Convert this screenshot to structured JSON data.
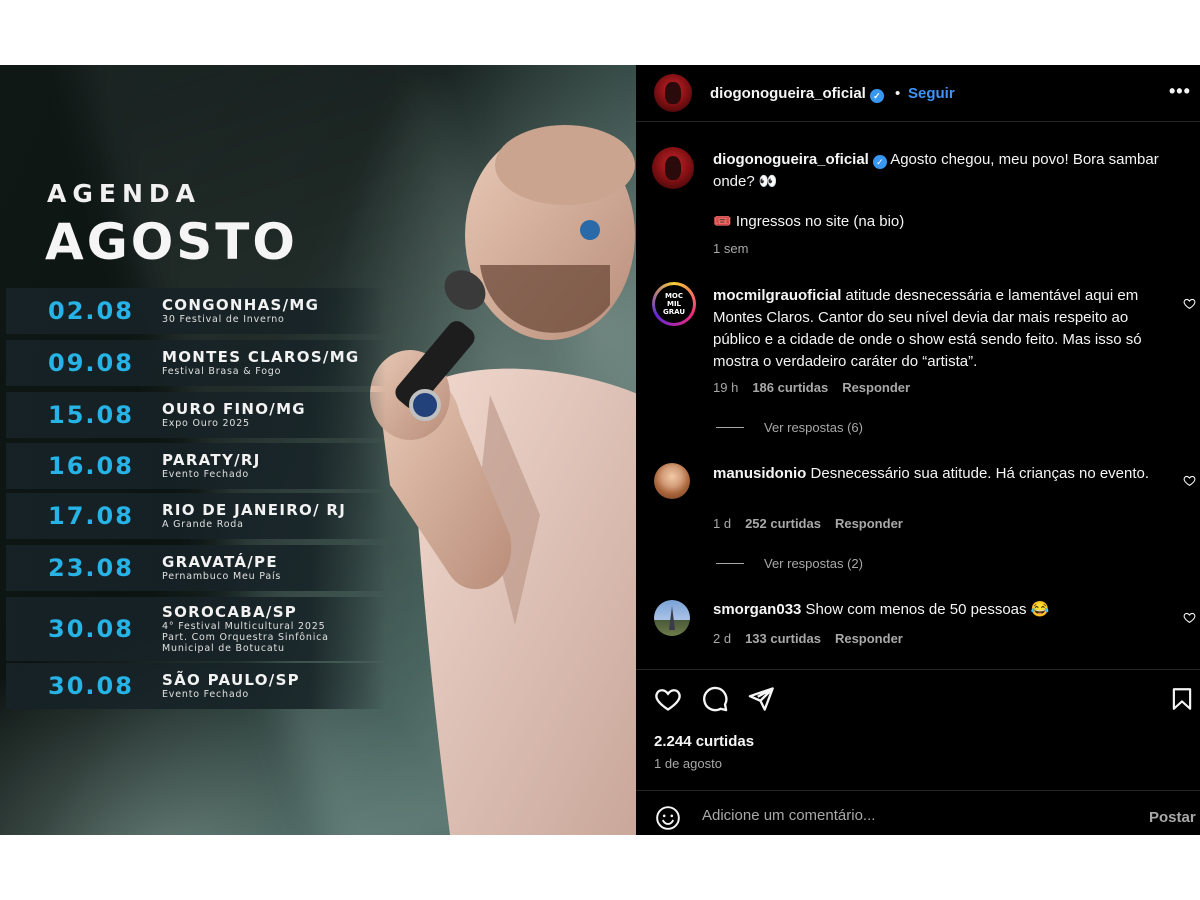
{
  "poster": {
    "title_small": "AGENDA",
    "title_big": "AGOSTO",
    "shows": [
      {
        "date": "02.08",
        "city": "CONGONHAS/MG",
        "details": [
          "30 Festival de Inverno"
        ]
      },
      {
        "date": "09.08",
        "city": "MONTES CLAROS/MG",
        "details": [
          "Festival Brasa & Fogo"
        ]
      },
      {
        "date": "15.08",
        "city": "OURO FINO/MG",
        "details": [
          "Expo Ouro 2025"
        ]
      },
      {
        "date": "16.08",
        "city": "PARATY/RJ",
        "details": [
          "Evento Fechado"
        ]
      },
      {
        "date": "17.08",
        "city": "RIO DE JANEIRO/ RJ",
        "details": [
          "A Grande Roda"
        ]
      },
      {
        "date": "23.08",
        "city": "GRAVATÁ/PE",
        "details": [
          "Pernambuco Meu País"
        ]
      },
      {
        "date": "30.08",
        "city": "SOROCABA/SP",
        "details": [
          "4° Festival Multicultural 2025",
          "Part. Com Orquestra Sinfônica",
          "Municipal de Botucatu"
        ]
      },
      {
        "date": "30.08",
        "city": "SÃO PAULO/SP",
        "details": [
          "Evento Fechado"
        ]
      }
    ]
  },
  "header": {
    "username": "diogonogueira_oficial",
    "separator": "•",
    "follow_label": "Seguir",
    "more_label": "•••"
  },
  "caption": {
    "username": "diogonogueira_oficial",
    "text": "Agosto chegou, meu povo! Bora sambar onde? 👀",
    "line2": "🎟️ Ingressos no site (na bio)",
    "time": "1 sem"
  },
  "comments": [
    {
      "username": "mocmilgrauoficial",
      "text": "atitude desnecessária e lamentável aqui em Montes Claros. Cantor do seu nível devia dar mais respeito ao público e a cidade de onde o show está sendo feito. Mas isso só mostra o verdadeiro caráter do “artista”.",
      "time": "19 h",
      "likes": "186 curtidas",
      "reply": "Responder",
      "view_replies": "Ver respostas (6)",
      "avatar_text": "MOC MIL GRAU"
    },
    {
      "username": "manusidonio",
      "text": "Desnecessário sua atitude. Há crianças no evento.",
      "time": "1 d",
      "likes": "252 curtidas",
      "reply": "Responder",
      "view_replies": "Ver respostas (2)"
    },
    {
      "username": "smorgan033",
      "text": "Show com menos de 50 pessoas 😂",
      "time": "2 d",
      "likes": "133 curtidas",
      "reply": "Responder"
    }
  ],
  "footer": {
    "likes": "2.244 curtidas",
    "date": "1 de agosto",
    "comment_placeholder": "Adicione um comentário...",
    "post_label": "Postar"
  },
  "colors": {
    "accent": "#3f93f5",
    "poster_date": "#27b3e6",
    "panel_bg": "#000000",
    "muted": "#a8a8a8"
  }
}
